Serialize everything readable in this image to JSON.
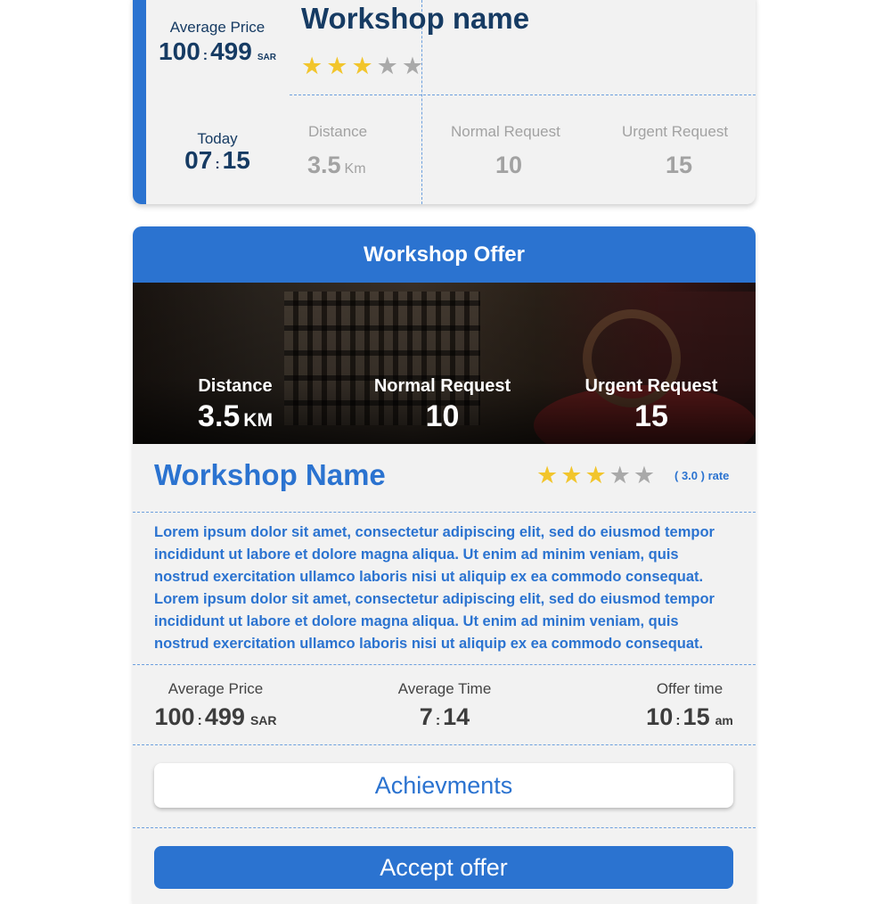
{
  "top_card": {
    "average_price_label": "Average Price",
    "price_min": "100",
    "price_sep": ":",
    "price_max": "499",
    "currency": "SAR",
    "today_label": "Today",
    "time_hour": "07",
    "time_sep": ":",
    "time_min": "15",
    "title": "Workshop name",
    "rating_stars": 3,
    "max_stars": 5,
    "stats": [
      {
        "label": "Distance",
        "value": "3.5",
        "unit": "Km"
      },
      {
        "label": "Normal Request",
        "value": "10"
      },
      {
        "label": "Urgent Request",
        "value": "15"
      }
    ]
  },
  "offer": {
    "header_title": "Workshop Offer",
    "hero_stats": [
      {
        "label": "Distance",
        "value": "3.5",
        "unit": "KM"
      },
      {
        "label": "Normal Request",
        "value": "10"
      },
      {
        "label": "Urgent Request",
        "value": "15"
      }
    ],
    "workshop_name": "Workshop Name",
    "rating_stars": 3,
    "rate_text": "( 3.0 ) rate",
    "description": "Lorem ipsum dolor sit amet, consectetur adipiscing elit, sed do eiusmod tempor incididunt ut labore et dolore magna aliqua. Ut enim ad minim veniam, quis nostrud exercitation ullamco laboris nisi ut aliquip ex ea commodo consequat. Lorem ipsum dolor sit amet, consectetur adipiscing elit, sed do eiusmod tempor incididunt ut labore et dolore magna aliqua. Ut enim ad minim veniam, quis nostrud exercitation ullamco laboris nisi ut aliquip ex ea commodo consequat.",
    "average_price_label": "Average Price",
    "price_min": "100",
    "price_sep": ":",
    "price_max": "499",
    "currency": "SAR",
    "average_time_label": "Average Time",
    "avg_time_a": "7",
    "avg_time_sep": ":",
    "avg_time_b": "14",
    "offer_time_label": "Offer time",
    "offer_hour": "10",
    "offer_sep": ":",
    "offer_min": "15",
    "offer_ampm": "am",
    "achievements_label": "Achievments",
    "accept_label": "Accept offer"
  },
  "colors": {
    "primary": "#2b73d0",
    "dark_text": "#163b63",
    "star_on": "#f2c52c",
    "star_off": "#a9a9a9",
    "muted": "#a2a2a2"
  }
}
